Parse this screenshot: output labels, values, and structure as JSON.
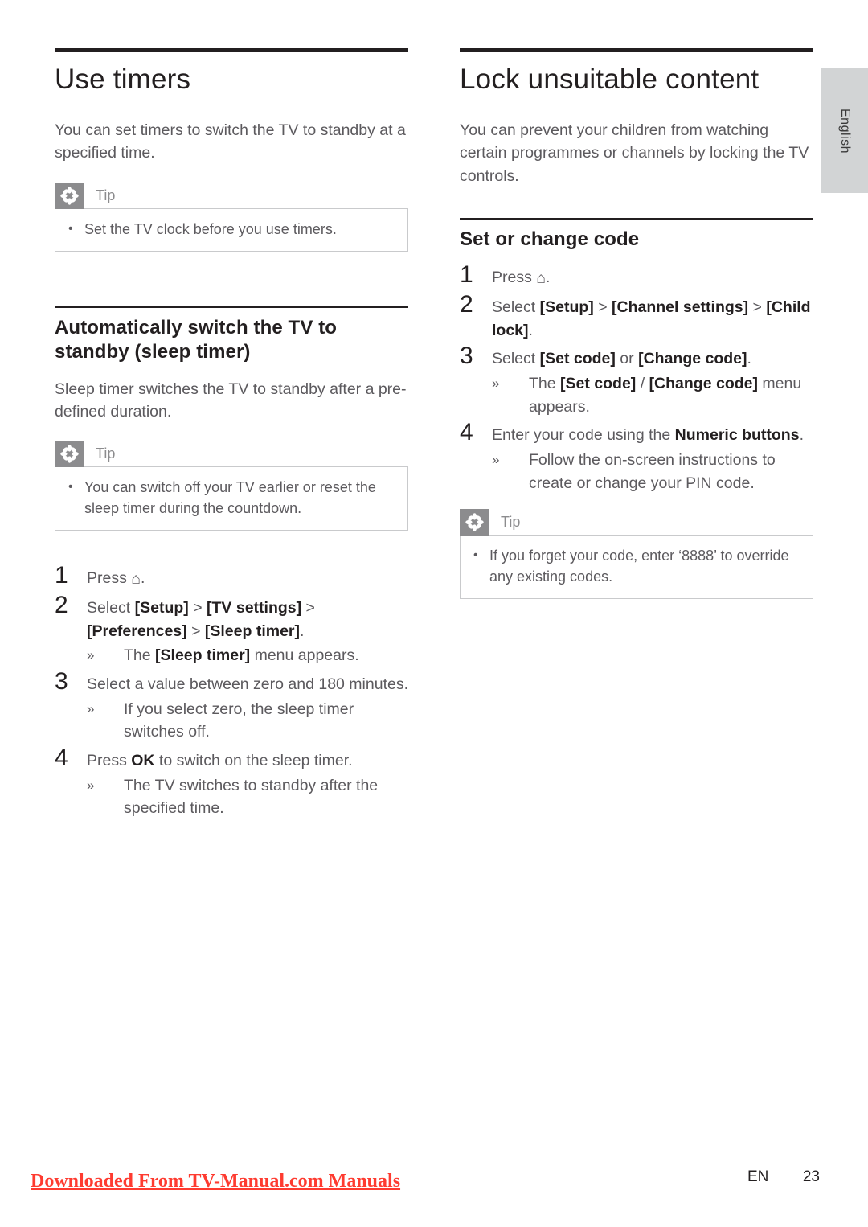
{
  "sidebar": {
    "language_tab": "English"
  },
  "left_column": {
    "chapter_title": "Use timers",
    "intro": "You can set timers to switch the TV to standby at a specified time.",
    "tip1": {
      "label": "Tip",
      "icon": "asterisk-icon",
      "items": [
        "Set the TV clock before you use timers."
      ]
    },
    "section_title": "Automatically switch the TV to standby (sleep timer)",
    "section_intro": "Sleep timer switches the TV to standby after a pre-defined duration.",
    "tip2": {
      "label": "Tip",
      "icon": "asterisk-icon",
      "items": [
        "You can switch off your TV earlier or reset the sleep timer during the countdown."
      ]
    },
    "steps": [
      {
        "number": "1",
        "text_html": "Press <span class=\"home-glyph\" data-name=\"home-icon\">⌂</span>.",
        "substeps": []
      },
      {
        "number": "2",
        "text_html": "Select <b>[Setup]</b> &gt; <b>[TV settings]</b> &gt; <b>[Preferences]</b> &gt; <b>[Sleep timer]</b>.",
        "substeps": [
          {
            "mark": "»",
            "text_html": "The <b>[Sleep timer]</b> menu appears."
          }
        ]
      },
      {
        "number": "3",
        "text_html": "Select a value between zero and 180 minutes.",
        "substeps": [
          {
            "mark": "»",
            "text_html": "If you select zero, the sleep timer switches off."
          }
        ]
      },
      {
        "number": "4",
        "text_html": "Press <b>OK</b> to switch on the sleep timer.",
        "substeps": [
          {
            "mark": "»",
            "text_html": "The TV switches to standby after the specified time."
          }
        ]
      }
    ]
  },
  "right_column": {
    "chapter_title": "Lock unsuitable content",
    "intro": "You can prevent your children from watching certain programmes or channels by locking the TV controls.",
    "subsection_title": "Set or change code",
    "steps": [
      {
        "number": "1",
        "text_html": "Press <span class=\"home-glyph\" data-name=\"home-icon\">⌂</span>.",
        "substeps": []
      },
      {
        "number": "2",
        "text_html": "Select <b>[Setup]</b> &gt; <b>[Channel settings]</b> &gt; <b>[Child lock]</b>.",
        "substeps": []
      },
      {
        "number": "3",
        "text_html": "Select <b>[Set code]</b> or <b>[Change code]</b>.",
        "substeps": [
          {
            "mark": "»",
            "text_html": "The <b>[Set code]</b> / <b>[Change code]</b> menu appears."
          }
        ]
      },
      {
        "number": "4",
        "text_html": "Enter your code using the <b>Numeric buttons</b>.",
        "substeps": [
          {
            "mark": "»",
            "text_html": "Follow the on-screen instructions to create or change your PIN code."
          }
        ]
      }
    ],
    "tip": {
      "label": "Tip",
      "icon": "asterisk-icon",
      "items": [
        "If you forget your code, enter ‘8888’ to override any existing codes."
      ]
    }
  },
  "footer": {
    "watermark": "Downloaded From TV-Manual.com Manuals",
    "language_code": "EN",
    "page_number": "23"
  },
  "colors": {
    "heading": "#231f20",
    "body_text": "#5c5a5e",
    "tip_gray": "#8c8c8e",
    "tab_gray": "#d2d4d5",
    "watermark_red": "#fe3b30"
  }
}
